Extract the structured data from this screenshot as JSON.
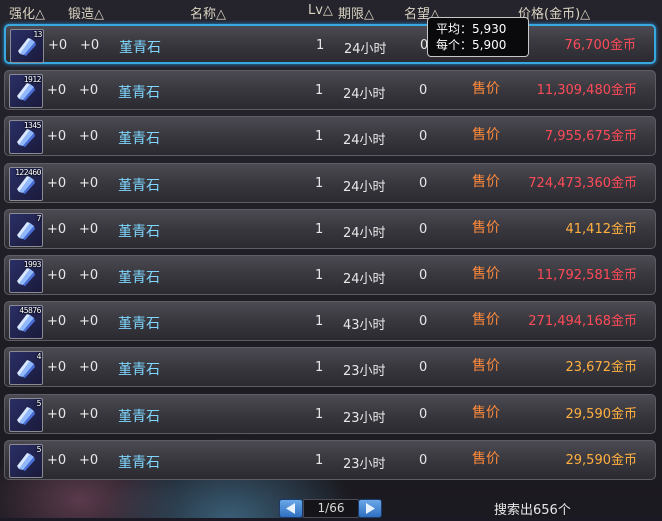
{
  "headers": {
    "enhance": "强化△",
    "forge": "锻造△",
    "name": "名称△",
    "lv": "Lv△",
    "duration": "期限△",
    "fame": "名望△",
    "price": "价格(金币)△"
  },
  "tooltip": {
    "avg_label": "平均：",
    "avg_value": "5,930",
    "each_label": "每个：",
    "each_value": "5,900"
  },
  "rows": [
    {
      "qty": "13",
      "enhance": "+0",
      "forge": "+0",
      "name": "堇青石",
      "lv": "1",
      "duration": "24小时",
      "fame": "0",
      "sell": "",
      "price": "76,700金币",
      "price_color": "red",
      "selected": true
    },
    {
      "qty": "1912",
      "enhance": "+0",
      "forge": "+0",
      "name": "堇青石",
      "lv": "1",
      "duration": "24小时",
      "fame": "0",
      "sell": "售价",
      "price": "11,309,480金币",
      "price_color": "red"
    },
    {
      "qty": "1345",
      "enhance": "+0",
      "forge": "+0",
      "name": "堇青石",
      "lv": "1",
      "duration": "24小时",
      "fame": "0",
      "sell": "售价",
      "price": "7,955,675金币",
      "price_color": "red"
    },
    {
      "qty": "122460",
      "enhance": "+0",
      "forge": "+0",
      "name": "堇青石",
      "lv": "1",
      "duration": "24小时",
      "fame": "0",
      "sell": "售价",
      "price": "724,473,360金币",
      "price_color": "red"
    },
    {
      "qty": "7",
      "enhance": "+0",
      "forge": "+0",
      "name": "堇青石",
      "lv": "1",
      "duration": "24小时",
      "fame": "0",
      "sell": "售价",
      "price": "41,412金币",
      "price_color": "orange"
    },
    {
      "qty": "1993",
      "enhance": "+0",
      "forge": "+0",
      "name": "堇青石",
      "lv": "1",
      "duration": "24小时",
      "fame": "0",
      "sell": "售价",
      "price": "11,792,581金币",
      "price_color": "red"
    },
    {
      "qty": "45876",
      "enhance": "+0",
      "forge": "+0",
      "name": "堇青石",
      "lv": "1",
      "duration": "43小时",
      "fame": "0",
      "sell": "售价",
      "price": "271,494,168金币",
      "price_color": "red"
    },
    {
      "qty": "4",
      "enhance": "+0",
      "forge": "+0",
      "name": "堇青石",
      "lv": "1",
      "duration": "23小时",
      "fame": "0",
      "sell": "售价",
      "price": "23,672金币",
      "price_color": "orange"
    },
    {
      "qty": "5",
      "enhance": "+0",
      "forge": "+0",
      "name": "堇青石",
      "lv": "1",
      "duration": "23小时",
      "fame": "0",
      "sell": "售价",
      "price": "29,590金币",
      "price_color": "orange"
    },
    {
      "qty": "5",
      "enhance": "+0",
      "forge": "+0",
      "name": "堇青石",
      "lv": "1",
      "duration": "23小时",
      "fame": "0",
      "sell": "售价",
      "price": "29,590金币",
      "price_color": "orange"
    }
  ],
  "pager": {
    "text": "1/66"
  },
  "result_text": "搜索出656个",
  "colors": {
    "price_red": "#ff4b57",
    "price_orange": "#ffb040",
    "name": "#7fd7ff",
    "selected_border": "#38a8e0"
  },
  "icons": {
    "item": "crystal-icon",
    "prev": "prev-page-arrow-icon",
    "next": "next-page-arrow-icon"
  }
}
